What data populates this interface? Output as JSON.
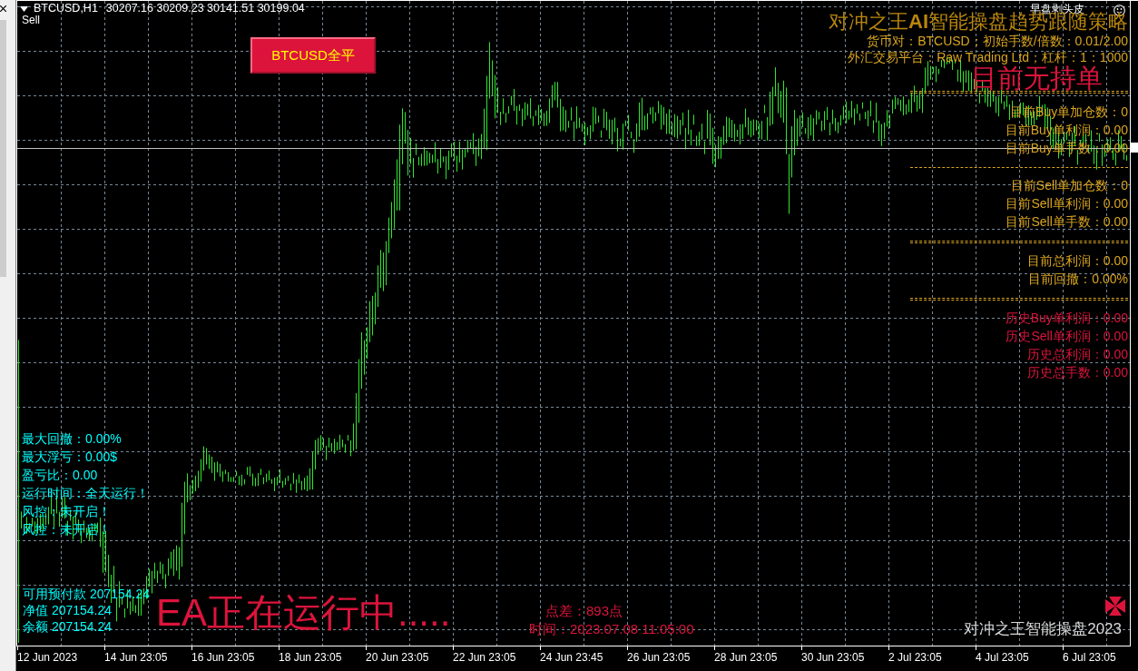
{
  "chart": {
    "symbol": "BTCUSD,H1",
    "ohlc": "30207.16 30209.23 30141.51 30199.04",
    "signal": "Sell",
    "close_all_button": "BTCUSD全平",
    "info_panel": {
      "mode_label": "早盘剥头皮",
      "title": "对冲之王**AI**智能操盘趋势跟随策略",
      "lines": [
        "货币对：BTCUSD；初始手数/倍数：0.01/2.00",
        "外汇交易平台：Raw Trading Ltd；杠杆：1：1000"
      ],
      "position_status": "目前无持单",
      "groups": [
        {
          "double_divider": true,
          "kind": "current",
          "rows": [
            "目前Buy单加仓数：0",
            "目前Buy单利润：0.00",
            "目前Buy单手数：0.00"
          ]
        },
        {
          "double_divider": false,
          "kind": "current",
          "rows": [
            "目前Sell单加仓数：0",
            "目前Sell单利润：0.00",
            "目前Sell单手数：0.00"
          ]
        },
        {
          "double_divider": true,
          "kind": "current",
          "rows": [
            "目前总利润：0.00",
            "目前回撤：0.00%"
          ]
        },
        {
          "double_divider": true,
          "kind": "history",
          "rows": [
            "历史Buy单利润：0.00",
            "历史Sell单利润：0.00",
            "历史总利润：0.00",
            "历史总手数：0.00"
          ]
        }
      ]
    },
    "risk_stats": [
      "最大回撤：0.00%",
      "最大浮亏：0.00$",
      "盈亏比：0.00",
      "运行时间：全天运行！",
      "风控：未开启！",
      "风控：未开启！"
    ],
    "account": [
      "可用预付款 207154.24",
      "净值 207154.24",
      "余额 207154.24"
    ],
    "ea_status": "EA正在运行中.....",
    "spread": "点差：893点",
    "time": "时间：2023.07.08 11:05:00",
    "brand": "对冲之王智能操盘2023"
  },
  "time_axis": {
    "labels": [
      "12 Jun 2023",
      "14 Jun 23:05",
      "16 Jun 23:05",
      "18 Jun 23:05",
      "20 Jun 23:05",
      "22 Jun 23:05",
      "24 Jun 23:45",
      "26 Jun 23:05",
      "28 Jun 23:05",
      "30 Jun 23:05",
      "2 Jul 23:05",
      "4 Jul 23:05",
      "6 Jul 23:05"
    ]
  }
}
